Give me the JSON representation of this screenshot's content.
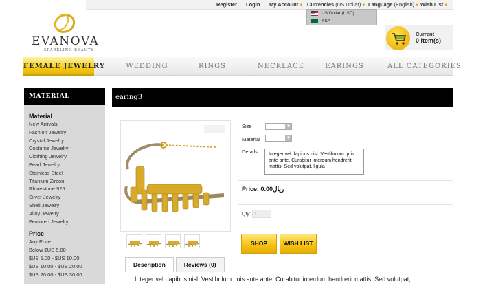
{
  "top_bar": {
    "register": "Register",
    "login": "Login",
    "my_account": "My Account",
    "currencies": "Currencies",
    "currencies_value": "(US Dollar)",
    "language": "Language",
    "language_value": "(English)",
    "wish_list": "Wish List"
  },
  "currency_dropdown": {
    "options": [
      "US Dollar (USD)",
      "KSA"
    ]
  },
  "logo": {
    "name": "EVANOVA",
    "tagline": "SPARKLING BEAUTY"
  },
  "cart": {
    "label": "Current",
    "count": "0 Item(s)"
  },
  "nav": {
    "items": [
      "FEMALE JEWELRY",
      "WEDDING",
      "RINGS",
      "NECKLACE",
      "EARINGS",
      "ALL CATEGORIES"
    ]
  },
  "sidebar": {
    "header": "MATERIAL",
    "material_title": "Material",
    "material_items": [
      "New Arrivals",
      "Fashion Jewelry",
      "Crystal Jewelry",
      "Costume Jewelry",
      "Clothing Jewelry",
      "Pearl Jewelry",
      "Stainless Steel",
      "Titanium Zircon",
      "Rhinestone 925",
      "Silver Jewelry",
      "Shell Jewelry",
      "Alloy Jewelry",
      "Featured Jewelry"
    ],
    "price_title": "Price",
    "price_items": [
      "Any Price",
      "Below $US 5.00",
      "$US 5.00 - $US 10.00",
      "$US 10.00 - $US 20.00",
      "$US 20.00 - $US 30.00"
    ]
  },
  "product": {
    "title": "earing3",
    "size_label": "Size",
    "material_label": "Material",
    "details_label": "Details",
    "details_text": "Integer vel dapibus nisl. Vestibulum quis ante ante. Curabitur interdum hendrerit mattis. Sed volutpat, ligula",
    "price": "Price: 0.00ريال",
    "qty_label": "Qty:",
    "qty_value": "1",
    "shop_button": "SHOP",
    "wishlist_button": "WISH LIST"
  },
  "tabs": {
    "description": "Description",
    "reviews": "Reviews (0)"
  },
  "description_text": "Integer vel dapibus nisl. Vestibulum quis ante ante. Curabitur interdum hendrerit mattis. Sed volutpat,",
  "colors": {
    "accent_gold": "#f4cd19",
    "header_black": "#000000",
    "sidebar_gray": "#d9d9d9"
  }
}
